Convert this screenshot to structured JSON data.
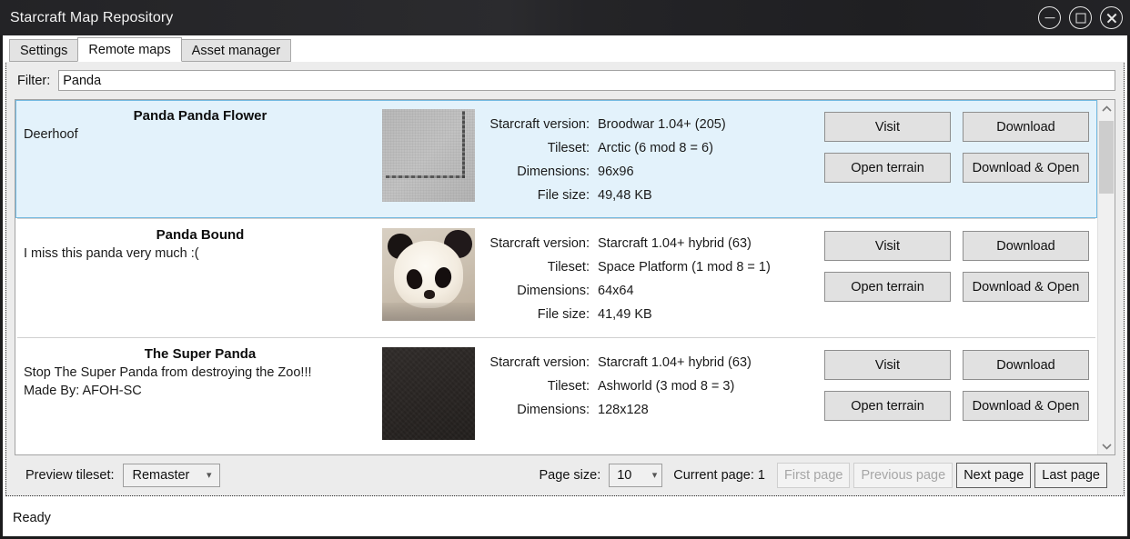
{
  "window": {
    "title": "Starcraft Map Repository",
    "controls": [
      {
        "name": "minimize",
        "icon": "minimize-icon"
      },
      {
        "name": "maximize",
        "icon": "maximize-icon"
      },
      {
        "name": "close",
        "icon": "close-icon"
      }
    ]
  },
  "tabs": [
    {
      "label": "Settings",
      "active": false
    },
    {
      "label": "Remote maps",
      "active": true
    },
    {
      "label": "Asset manager",
      "active": false
    }
  ],
  "filter": {
    "label": "Filter:",
    "value": "Panda",
    "placeholder": ""
  },
  "meta_labels": {
    "version": "Starcraft version:",
    "tileset": "Tileset:",
    "dimensions": "Dimensions:",
    "filesize": "File size:"
  },
  "buttons": {
    "visit": "Visit",
    "download": "Download",
    "open_terrain": "Open terrain",
    "download_open": "Download & Open"
  },
  "maps": [
    {
      "title": "Panda Panda Flower",
      "description": "Deerhoof",
      "description2": "",
      "version": "Broodwar 1.04+ (205)",
      "tileset": "Arctic (6 mod 8 = 6)",
      "dimensions": "96x96",
      "filesize": "49,48 KB",
      "selected": true,
      "thumb": "terrain-grey-thumbnail"
    },
    {
      "title": "Panda Bound",
      "description": "I miss this panda very much :(",
      "description2": "",
      "version": "Starcraft 1.04+ hybrid (63)",
      "tileset": "Space Platform (1 mod 8 = 1)",
      "dimensions": "64x64",
      "filesize": "41,49 KB",
      "selected": false,
      "thumb": "panda-photo-thumbnail"
    },
    {
      "title": "The Super Panda",
      "description": "Stop The Super Panda from destroying the Zoo!!!",
      "description2": "Made By: AFOH-SC",
      "version": "Starcraft 1.04+ hybrid (63)",
      "tileset": "Ashworld (3 mod 8 = 3)",
      "dimensions": "128x128",
      "filesize": "",
      "selected": false,
      "thumb": "terrain-dark-thumbnail"
    }
  ],
  "bottom": {
    "preview_label": "Preview tileset:",
    "preview_value": "Remaster",
    "page_size_label": "Page size:",
    "page_size_value": "10",
    "current_page_label": "Current page: 1",
    "first_page": "First page",
    "previous_page": "Previous page",
    "next_page": "Next page",
    "last_page": "Last page"
  },
  "status": {
    "text": "Ready"
  },
  "colors": {
    "selection_bg": "#e3f2fb",
    "selection_border": "#73b9e0",
    "titlebar": "#232326",
    "panel": "#ececec"
  }
}
